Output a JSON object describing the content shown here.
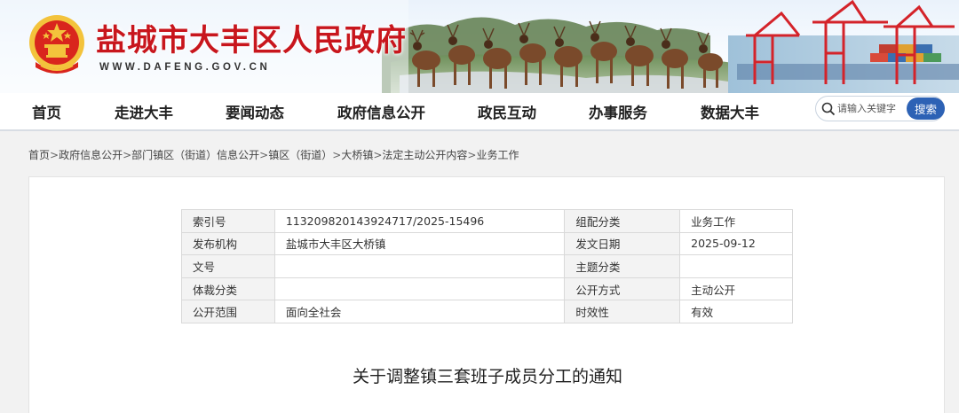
{
  "site": {
    "title": "盐城市大丰区人民政府",
    "domain": "WWW.DAFENG.GOV.CN"
  },
  "nav": {
    "items": [
      {
        "label": "首页"
      },
      {
        "label": "走进大丰"
      },
      {
        "label": "要闻动态"
      },
      {
        "label": "政府信息公开"
      },
      {
        "label": "政民互动"
      },
      {
        "label": "办事服务"
      },
      {
        "label": "数据大丰"
      }
    ]
  },
  "search": {
    "placeholder": "请输入关键字",
    "button_label": "搜索"
  },
  "breadcrumb": {
    "items": [
      "首页",
      "政府信息公开",
      "部门镇区（街道）信息公开",
      "镇区（街道）",
      "大桥镇",
      "法定主动公开内容",
      "业务工作"
    ],
    "separator": ">"
  },
  "meta": {
    "rows": [
      {
        "k1": "索引号",
        "v1": "113209820143924717/2025-15496",
        "k2": "组配分类",
        "v2": "业务工作"
      },
      {
        "k1": "发布机构",
        "v1": "盐城市大丰区大桥镇",
        "k2": "发文日期",
        "v2": "2025-09-12"
      },
      {
        "k1": "文号",
        "v1": "",
        "k2": "主题分类",
        "v2": ""
      },
      {
        "k1": "体裁分类",
        "v1": "",
        "k2": "公开方式",
        "v2": "主动公开"
      },
      {
        "k1": "公开范围",
        "v1": "面向全社会",
        "k2": "时效性",
        "v2": "有效"
      }
    ]
  },
  "article": {
    "title": "关于调整镇三套班子成员分工的通知"
  },
  "colors": {
    "brand_red": "#c8161d",
    "search_blue": "#2d62b5",
    "emblem_gold": "#f3c33c"
  }
}
